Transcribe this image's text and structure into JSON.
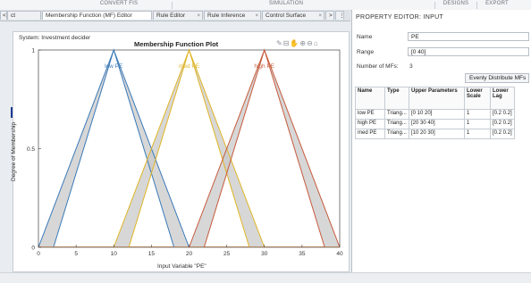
{
  "toolstrip": {
    "sections": [
      "CONVERT FIS",
      "SIMULATION",
      "DESIGNS",
      "EXPORT"
    ]
  },
  "tabs": [
    {
      "label": "<",
      "closable": false
    },
    {
      "label": "ct",
      "closable": false
    },
    {
      "label": "Membership Function (MF) Editor",
      "closable": false
    },
    {
      "label": "Rule Editor",
      "closable": true
    },
    {
      "label": "Rule Inference",
      "closable": true
    },
    {
      "label": "Control Surface",
      "closable": true
    },
    {
      "label": ">",
      "closable": false
    },
    {
      "label": "⋮",
      "closable": false
    }
  ],
  "tab_close_glyph": "×",
  "system_label": "System: Investment decider",
  "plot": {
    "title": "Membership Function Plot",
    "tool_icons": [
      "pencil-icon",
      "data-cursor-icon",
      "pan-icon",
      "zoom-in-icon",
      "zoom-out-icon",
      "home-icon"
    ],
    "tool_glyphs": "✎⊟✋⊕⊖⌂"
  },
  "chart_data": {
    "type": "line",
    "title": "Membership Function Plot",
    "xlabel": "Input Variable \"PE\"",
    "ylabel": "Degree of Membership",
    "xlim": [
      0,
      40
    ],
    "ylim": [
      0,
      1
    ],
    "x_ticks": [
      0,
      5,
      10,
      15,
      20,
      25,
      30,
      35,
      40
    ],
    "y_ticks": [
      0,
      0.5,
      1
    ],
    "y_tick_labels": [
      "0",
      "0.5",
      "1"
    ],
    "grid": false,
    "series": [
      {
        "name": "low PE",
        "color": "#3a7ab8",
        "upper": [
          0,
          10,
          20
        ],
        "lower": [
          2,
          10,
          18
        ],
        "lower_scale": 1
      },
      {
        "name": "med PE",
        "color": "#e0b526",
        "upper": [
          10,
          20,
          30
        ],
        "lower": [
          12,
          20,
          28
        ],
        "lower_scale": 1
      },
      {
        "name": "high PE",
        "color": "#c65b3c",
        "upper": [
          20,
          30,
          40
        ],
        "lower": [
          22,
          30,
          38
        ],
        "lower_scale": 1
      }
    ],
    "fou_color": "#c9c9c9"
  },
  "property_editor": {
    "heading": "PROPERTY EDITOR: INPUT",
    "name_label": "Name",
    "name_value": "PE",
    "range_label": "Range",
    "range_value": "[0 40]",
    "num_mfs_label": "Number of MFs:",
    "num_mfs_value": "3",
    "distribute_button": "Evenly Distribute MFs",
    "table": {
      "columns": [
        "Name",
        "Type",
        "Upper Parameters",
        "Lower Scale",
        "Lower Lag"
      ],
      "rows": [
        [
          "low PE",
          "Triang...",
          "[0 10 20]",
          "1",
          "[0.2 0.2]"
        ],
        [
          "high PE",
          "Triang...",
          "[20 30 40]",
          "1",
          "[0.2 0.2]"
        ],
        [
          "med PE",
          "Triang...",
          "[10 20 30]",
          "1",
          "[0.2 0.2]"
        ]
      ]
    }
  }
}
